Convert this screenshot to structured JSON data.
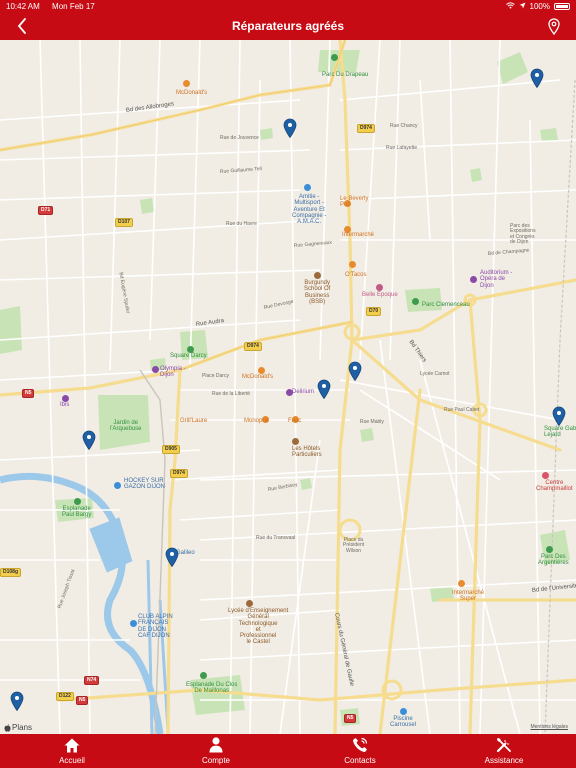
{
  "status": {
    "time": "10:42 AM",
    "date": "Mon Feb 17",
    "battery": "100%"
  },
  "nav": {
    "title": "Réparateurs agréés"
  },
  "map": {
    "attribution": "Plans",
    "legal": "Mentions légales",
    "markers": [
      {
        "id": "m1"
      },
      {
        "id": "m2"
      },
      {
        "id": "m3"
      },
      {
        "id": "m4"
      },
      {
        "id": "m5"
      },
      {
        "id": "m6"
      },
      {
        "id": "m7"
      },
      {
        "id": "m8"
      }
    ],
    "labels": {
      "parc_drapeau": "Parc Du Drapeau",
      "mcdonalds1": "McDonald's",
      "bd_allobroges": "Bd des Allobroges",
      "amitie": "Amitie -\nMultisport -\nAventure Et\nCompagnie -\nA.M.A.C.",
      "beverly": "Le Beverly\nPub",
      "intermarche1": "Intermarché",
      "parc_expo": "Parc des\nExpositions\net Congrès\nde Dijon",
      "auditorium": "Auditorium -\nOpéra de\nDijon",
      "burgundy": "Burgundy\nSchool Of\nBusiness\n(BSB)",
      "otacos": "O'Tacos",
      "belle_epoque": "Belle Époque",
      "parc_clemenceau": "Parc Clemenceau",
      "square_darcy": "Square Darcy",
      "olympia": "Olympia -\nDijon",
      "place_darcy": "Place Darcy",
      "mcdonalds2": "McDonald's",
      "delirium": "Delirium",
      "lycee_carnot": "Lycée Carnot",
      "ibis": "Ibis",
      "jardin_arquebuse": "Jardin de\nl'Arquebuse",
      "grill_laure": "Grill'Laure",
      "monoprix": "Monoprix",
      "fnac": "Fnac",
      "square_gabriel": "Square Gab\nLejard",
      "hotels_particuliers": "Les Hôtels\nParticuliers",
      "centre_champmaillot": "Centre\nChampmaillot",
      "hockey": "HOCKEY SUR\nGAZON DIJON",
      "esplanade_bargy": "Esplanade\nPaul Bargy",
      "place_wilson": "Place du\nPrésident\nWilson",
      "parc_argentieres": "Parc Des\nArgentières",
      "intermarche2": "Intermarché\nSuper",
      "club_alpin": "CLUB ALPIN\nFRANÇAIS\nDE DIJON\nCAF DIJON",
      "lycee_castel": "Lycée d'Enseignement\nGénéral\nTechnologique\net\nProfessionnel\nle Castel",
      "esplanade_mailles": "Esplanade Du Clos\nDe Maillonas",
      "piscine": "Piscine\nCarrousel",
      "rue_havre": "Rue du Havre",
      "rue_guillaume": "Rue Guillaume Tell",
      "rue_audra": "Rue Audra",
      "bd_thiers": "Bd Thiers",
      "bd_universite": "Bd de l'Université",
      "rue_chancy": "Rue Chancy",
      "rue_ladevide": "Rue Lafayette",
      "cours_general": "Cours du Général de Gaulle",
      "rue_charrue": "Rue de Jouvence",
      "bd_champagne": "Bd de Champagne",
      "rue_liberte": "Rue de la Liberté",
      "rue_gagnerau": "Rue Gagnereaux",
      "rue_devosge": "Rue Devosge",
      "bd_eugene": "Bd Eugène Spuller",
      "rue_transvaal": "Rue du Transvaal",
      "rue_paul_cabet": "Rue Paul Cabet",
      "rue_berbisey": "Rue Berbisey",
      "ave_gare": "Galileo",
      "rue_mably": "Rue Mably",
      "rue_joseph": "Rue Joseph Tissot"
    },
    "shields": {
      "d974a": "D974",
      "d107": "D107",
      "d71": "D71",
      "d974b": "D974",
      "d70": "D70",
      "n5a": "N5",
      "d905": "D905",
      "d974c": "D974",
      "d108g": "D108g",
      "n74": "N74",
      "d122": "D122",
      "n5b": "N5",
      "n5c": "N5"
    }
  },
  "tabs": [
    {
      "label": "Accueil",
      "icon": "home-icon"
    },
    {
      "label": "Compte",
      "icon": "user-icon"
    },
    {
      "label": "Contacts",
      "icon": "phone-icon"
    },
    {
      "label": "Assistance",
      "icon": "tools-icon"
    }
  ],
  "colors": {
    "brand": "#c60b14",
    "marker": "#1f5fa3",
    "park": "#c6e3b5",
    "water": "#9cc8ea",
    "major_road": "#f6dc8f"
  }
}
